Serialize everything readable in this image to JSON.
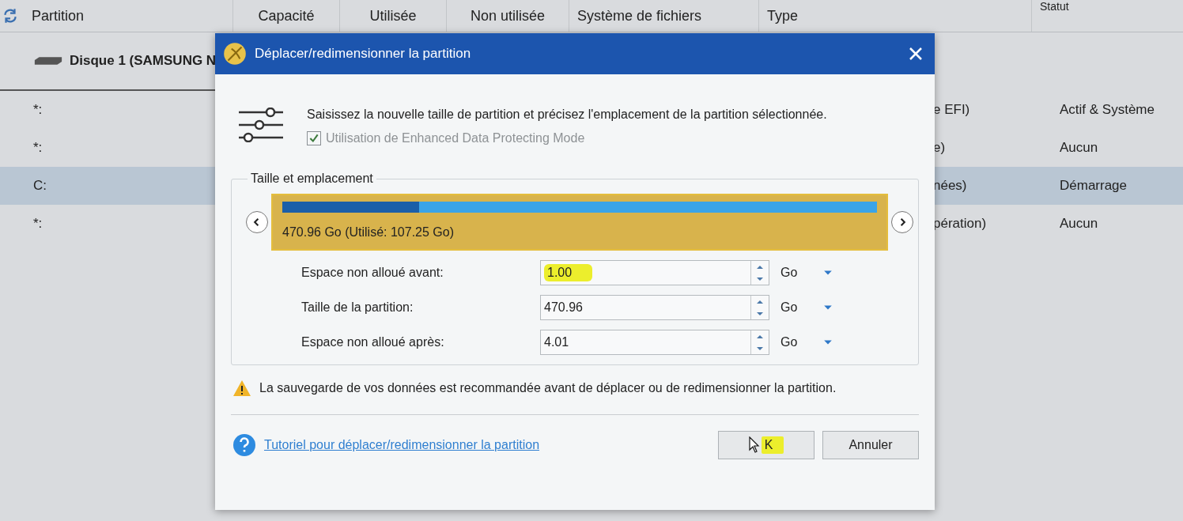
{
  "table": {
    "columns": [
      "Partition",
      "Capacité",
      "Utilisée",
      "Non utilisée",
      "Système de fichiers",
      "Type",
      "Statut"
    ],
    "disk": {
      "label": "Disque 1 (SAMSUNG N"
    },
    "rows": [
      {
        "partition": "*:",
        "type": "e EFI)",
        "status": "Actif & Système",
        "selected": false
      },
      {
        "partition": "*:",
        "type": "e)",
        "status": "Aucun",
        "selected": false
      },
      {
        "partition": "C:",
        "type": "nées)",
        "status": "Démarrage",
        "selected": true
      },
      {
        "partition": "*:",
        "type": "pération)",
        "status": "Aucun",
        "selected": false
      }
    ]
  },
  "dialog": {
    "title": "Déplacer/redimensionner la partition",
    "description": "Saisissez la nouvelle taille de partition et précisez l'emplacement de la partition sélectionnée.",
    "protect_mode": {
      "label": "Utilisation de Enhanced Data Protecting Mode",
      "checked": true,
      "disabled": true
    },
    "group_title": "Taille et emplacement",
    "partition_bar": {
      "label": "470.96 Go (Utilisé: 107.25 Go)",
      "level": 0.23
    },
    "fields": [
      {
        "label": "Espace non alloué avant:",
        "value": "1.00",
        "unit": "Go",
        "highlighted": true
      },
      {
        "label": "Taille de la partition:",
        "value": "470.96",
        "unit": "Go",
        "highlighted": false
      },
      {
        "label": "Espace non alloué après:",
        "value": "4.01",
        "unit": "Go",
        "highlighted": false
      }
    ],
    "warning": "La sauvegarde de vos données est recommandée avant de déplacer ou de redimensionner la partition.",
    "help_link": "Tutoriel pour déplacer/redimensionner la partition",
    "buttons": [
      {
        "label": "K",
        "highlighted": true
      },
      {
        "label": "Annuler",
        "highlighted": false
      }
    ]
  }
}
